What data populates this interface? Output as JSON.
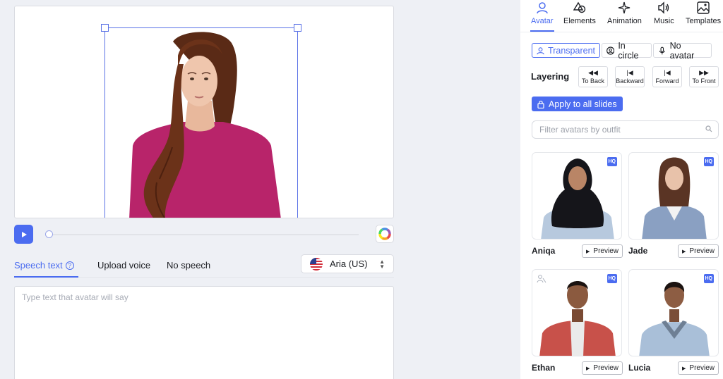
{
  "editor": {
    "tabs": {
      "speech_text": "Speech text",
      "upload_voice": "Upload voice",
      "no_speech": "No speech"
    },
    "help_icon": "?",
    "voice": {
      "name": "Aria (US)",
      "flag": "us-flag-icon"
    },
    "speech_placeholder": "Type text that avatar will say",
    "progress": 0
  },
  "panel": {
    "tabs": [
      {
        "label": "Avatar",
        "icon": "person-icon",
        "active": true
      },
      {
        "label": "Elements",
        "icon": "shapes-icon"
      },
      {
        "label": "Animation",
        "icon": "sparkle-icon"
      },
      {
        "label": "Music",
        "icon": "speaker-icon"
      },
      {
        "label": "Templates",
        "icon": "image-icon"
      }
    ],
    "modes": [
      {
        "label": "Transparent",
        "icon": "person-icon",
        "active": true
      },
      {
        "label": "In circle",
        "icon": "person-circle-icon"
      },
      {
        "label": "No avatar",
        "icon": "microphone-icon"
      }
    ],
    "layering": {
      "label": "Layering",
      "buttons": [
        {
          "label": "To Back",
          "icon": "rewind-icon"
        },
        {
          "label": "Backward",
          "icon": "step-back-icon"
        },
        {
          "label": "Forward",
          "icon": "step-forward-icon"
        },
        {
          "label": "To Front",
          "icon": "fast-forward-icon"
        }
      ]
    },
    "apply_all": "Apply to all slides",
    "filter_placeholder": "Filter avatars by outfit",
    "hq_label": "HQ",
    "preview_label": "Preview",
    "avatars": [
      {
        "name": "Aniqa",
        "hq": true
      },
      {
        "name": "Jade",
        "hq": true
      },
      {
        "name": "Ethan",
        "hq": true
      },
      {
        "name": "Lucia",
        "hq": true
      }
    ]
  },
  "colors": {
    "accent": "#4b6cf0",
    "sweater": "#b8246a",
    "background": "#eef0f5"
  }
}
